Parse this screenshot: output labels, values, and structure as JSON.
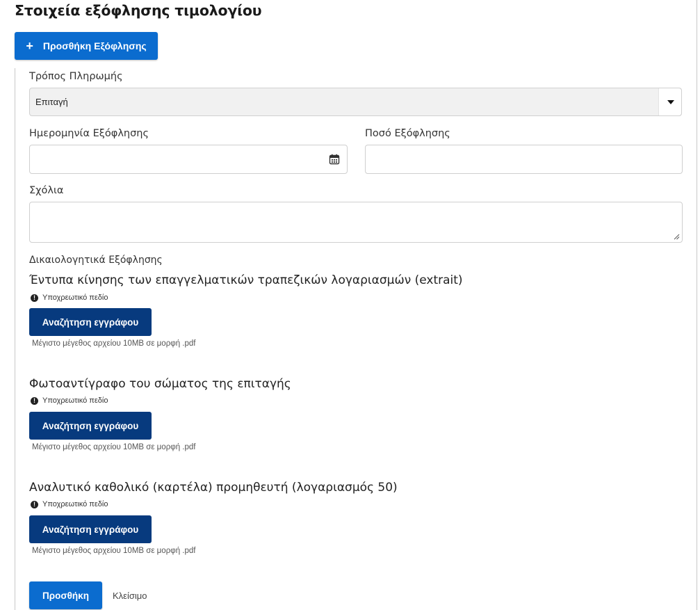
{
  "page": {
    "title": "Στοιχεία εξόφλησης τιμολογίου"
  },
  "toolbar": {
    "add_payment_label": "Προσθήκη Εξόφλησης",
    "add_payment_icon": "plus-icon"
  },
  "form": {
    "payment_method": {
      "label": "Τρόπος Πληρωμής",
      "selected": "Επιταγή"
    },
    "payment_date": {
      "label": "Ημερομηνία Εξόφλησης",
      "value": "",
      "icon": "calendar-icon"
    },
    "payment_amount": {
      "label": "Ποσό Εξόφλησης",
      "value": ""
    },
    "comments": {
      "label": "Σχόλια",
      "value": ""
    },
    "documents_label": "Δικαιολογητικά Εξόφλησης",
    "documents": [
      {
        "title": "Έντυπα κίνησης των επαγγελματικών τραπεζικών λογαριασμών (extrait)",
        "required_text": "Υποχρεωτικό πεδίο",
        "button_label": "Αναζήτηση εγγράφου",
        "hint": "Μέγιστο μέγεθος αρχείου 10MB σε μορφή .pdf"
      },
      {
        "title": "Φωτοαντίγραφο του σώματος της επιταγής",
        "required_text": "Υποχρεωτικό πεδίο",
        "button_label": "Αναζήτηση εγγράφου",
        "hint": "Μέγιστο μέγεθος αρχείου 10MB σε μορφή .pdf"
      },
      {
        "title": "Αναλυτικό καθολικό (καρτέλα) προμηθευτή (λογαριασμός 50)",
        "required_text": "Υποχρεωτικό πεδίο",
        "button_label": "Αναζήτηση εγγράφου",
        "hint": "Μέγιστο μέγεθος αρχείου 10MB σε μορφή .pdf"
      }
    ]
  },
  "actions": {
    "submit_label": "Προσθήκη",
    "close_label": "Κλείσιμο"
  },
  "colors": {
    "primary": "#0b6ccf",
    "dark_button": "#073a7e"
  }
}
